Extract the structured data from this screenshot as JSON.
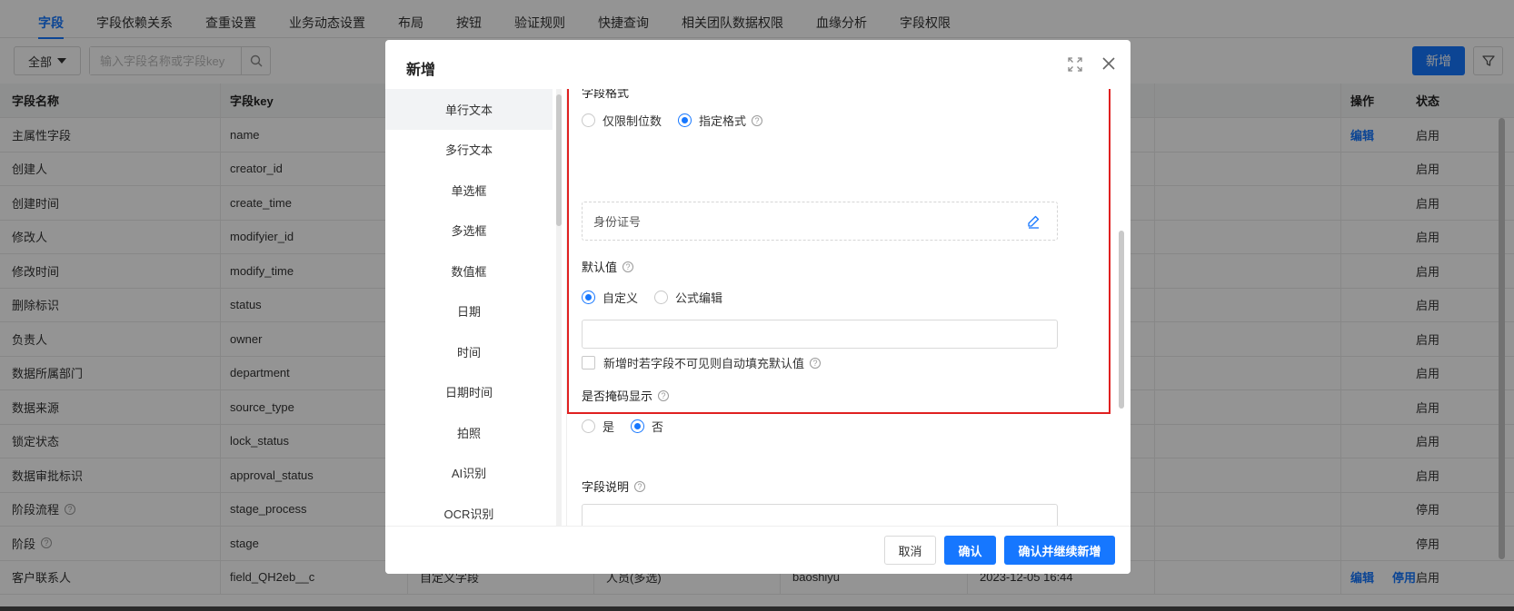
{
  "tabs": [
    "字段",
    "字段依赖关系",
    "查重设置",
    "业务动态设置",
    "布局",
    "按钮",
    "验证规则",
    "快捷查询",
    "相关团队数据权限",
    "血缘分析",
    "字段权限"
  ],
  "active_tab": "字段",
  "toolbar": {
    "filter_label": "全部",
    "search_placeholder": "输入字段名称或字段key",
    "add_label": "新增"
  },
  "table": {
    "headers": [
      "字段名称",
      "字段key",
      "",
      "",
      "",
      "",
      "",
      "状态",
      "操作"
    ],
    "rows": [
      {
        "name": "主属性字段",
        "key": "name",
        "type": "",
        "format": "",
        "creator": "",
        "time": "",
        "status": "启用",
        "actions": [
          "编辑"
        ],
        "help": false
      },
      {
        "name": "创建人",
        "key": "creator_id",
        "type": "",
        "format": "",
        "creator": "",
        "time": "",
        "status": "启用",
        "actions": [],
        "help": false
      },
      {
        "name": "创建时间",
        "key": "create_time",
        "type": "",
        "format": "",
        "creator": "",
        "time": "",
        "status": "启用",
        "actions": [],
        "help": false
      },
      {
        "name": "修改人",
        "key": "modifyier_id",
        "type": "",
        "format": "",
        "creator": "",
        "time": "",
        "status": "启用",
        "actions": [],
        "help": false
      },
      {
        "name": "修改时间",
        "key": "modify_time",
        "type": "",
        "format": "",
        "creator": "",
        "time": "",
        "status": "启用",
        "actions": [],
        "help": false
      },
      {
        "name": "删除标识",
        "key": "status",
        "type": "",
        "format": "",
        "creator": "",
        "time": "",
        "status": "启用",
        "actions": [],
        "help": false
      },
      {
        "name": "负责人",
        "key": "owner",
        "type": "",
        "format": "",
        "creator": "",
        "time": "",
        "status": "启用",
        "actions": [],
        "help": false
      },
      {
        "name": "数据所属部门",
        "key": "department",
        "type": "",
        "format": "",
        "creator": "",
        "time": "",
        "status": "启用",
        "actions": [],
        "help": false
      },
      {
        "name": "数据来源",
        "key": "source_type",
        "type": "",
        "format": "",
        "creator": "",
        "time": "",
        "status": "启用",
        "actions": [],
        "help": false
      },
      {
        "name": "锁定状态",
        "key": "lock_status",
        "type": "",
        "format": "",
        "creator": "",
        "time": "",
        "status": "启用",
        "actions": [],
        "help": false
      },
      {
        "name": "数据审批标识",
        "key": "approval_status",
        "type": "",
        "format": "",
        "creator": "",
        "time": "",
        "status": "启用",
        "actions": [],
        "help": false
      },
      {
        "name": "阶段流程",
        "key": "stage_process",
        "type": "",
        "format": "",
        "creator": "",
        "time": "",
        "status": "停用",
        "actions": [],
        "help": true
      },
      {
        "name": "阶段",
        "key": "stage",
        "type": "",
        "format": "",
        "creator": "",
        "time": "",
        "status": "停用",
        "actions": [],
        "help": true
      },
      {
        "name": "客户联系人",
        "key": "field_QH2eb__c",
        "type": "自定义字段",
        "format": "人员(多选)",
        "creator": "baoshiyu",
        "time": "2023-12-05 16:44",
        "status": "启用",
        "actions": [
          "编辑",
          "停用"
        ],
        "help": false
      }
    ]
  },
  "modal": {
    "title": "新增",
    "side_items": [
      "单行文本",
      "多行文本",
      "单选框",
      "多选框",
      "数值框",
      "日期",
      "时间",
      "日期时间",
      "拍照",
      "AI识别",
      "OCR识别"
    ],
    "active_side": "单行文本",
    "field_format": {
      "label": "字段格式",
      "options": [
        "仅限制位数",
        "指定格式"
      ],
      "selected": "指定格式",
      "value": "身份证号"
    },
    "default_value": {
      "label": "默认值",
      "options": [
        "自定义",
        "公式编辑"
      ],
      "selected": "自定义",
      "input_value": "",
      "auto_fill_label": "新增时若字段不可见则自动填充默认值",
      "auto_fill_checked": false
    },
    "mask": {
      "label": "是否掩码显示",
      "options": [
        "是",
        "否"
      ],
      "selected": "否"
    },
    "description": {
      "label": "字段说明",
      "value": ""
    },
    "buttons": {
      "cancel": "取消",
      "confirm": "确认",
      "confirm_continue": "确认并继续新增"
    }
  },
  "colors": {
    "accent": "#1677ff",
    "highlight": "#e02020"
  }
}
